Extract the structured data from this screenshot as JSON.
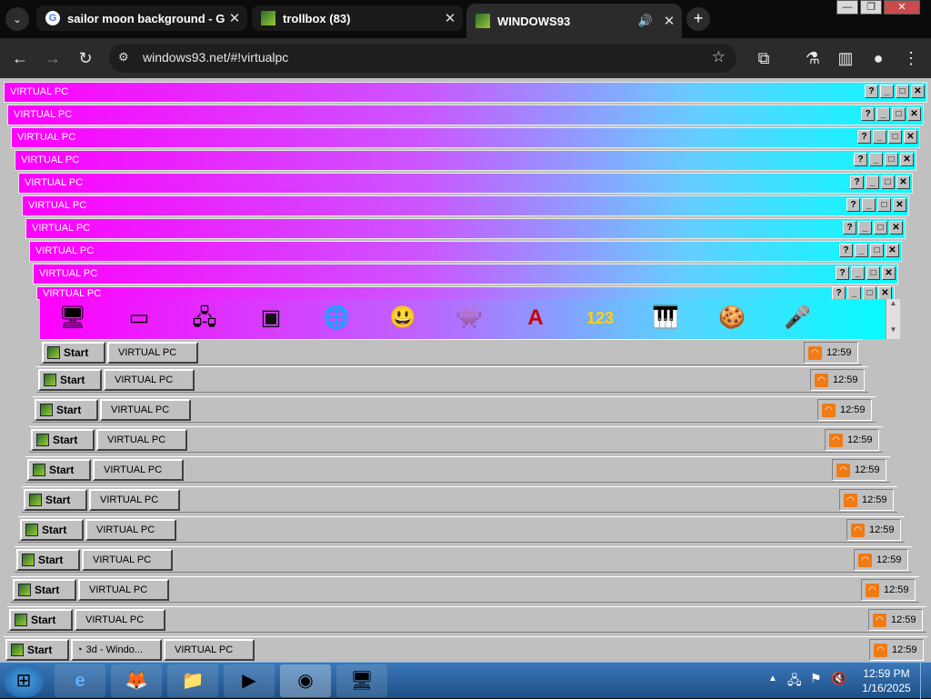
{
  "browser": {
    "tabs": [
      {
        "title": "sailor moon background - Goo",
        "close": "✕"
      },
      {
        "title": "trollbox (83)",
        "close": "✕"
      },
      {
        "title": "WINDOWS93",
        "close": "✕"
      }
    ],
    "new_tab": "+",
    "url": "windows93.net/#!virtualpc"
  },
  "vpc": {
    "title": "VIRTUAL PC",
    "help": "?",
    "min": "_",
    "max": "□",
    "close": "✕"
  },
  "start": "Start",
  "task_label": "VIRTUAL PC",
  "task_label_extra": "3d - Windo...",
  "clock": "12:59",
  "taskbar7": {
    "time": "12:59 PM",
    "date": "1/16/2025"
  },
  "colors": {
    "accent_magenta": "#ff00ff",
    "accent_cyan": "#00ffff",
    "rss": "#f07a14"
  }
}
